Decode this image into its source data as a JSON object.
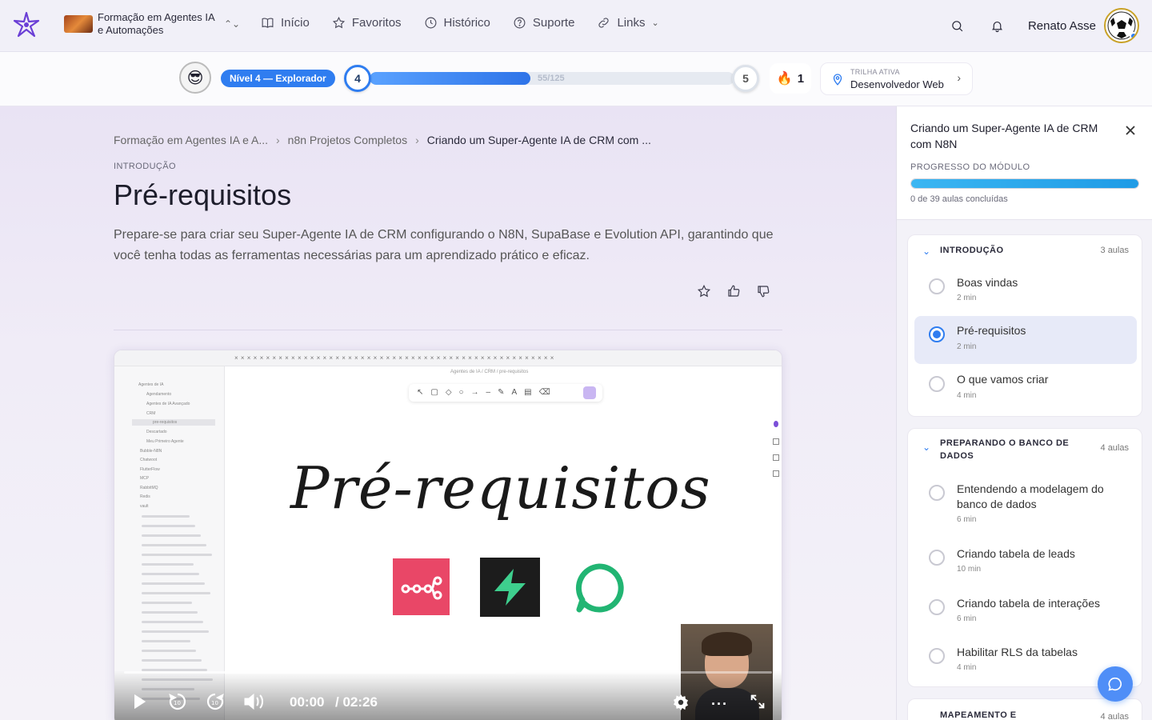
{
  "nav": {
    "course_name": "Formação em Agentes IA e Automações",
    "links": [
      {
        "label": "Início",
        "icon": "book-icon"
      },
      {
        "label": "Favoritos",
        "icon": "star-icon"
      },
      {
        "label": "Histórico",
        "icon": "clock-icon"
      },
      {
        "label": "Suporte",
        "icon": "help-icon"
      },
      {
        "label": "Links",
        "icon": "link-icon"
      }
    ],
    "user_name": "Renato Asse"
  },
  "level": {
    "badge": "Nível 4 — Explorador",
    "current_level": "4",
    "next_level": "5",
    "xp_text": "55/125",
    "xp_fraction": 0.44,
    "streak": "1",
    "trail_label": "TRILHA ATIVA",
    "trail_name": "Desenvolvedor Web"
  },
  "breadcrumb": {
    "items": [
      "Formação em Agentes IA e A...",
      "n8n Projetos Completos",
      "Criando um Super-Agente IA de CRM com ..."
    ]
  },
  "lesson": {
    "section": "INTRODUÇÃO",
    "title": "Pré-requisitos",
    "description": "Prepare-se para criar seu Super-Agente IA de CRM configurando o N8N, SupaBase e Evolution API, garantindo que você tenha todas as ferramentas necessárias para um aprendizado prático e eficaz."
  },
  "video": {
    "path_label": "Agentes de IA / CRM / pre-requisitos",
    "slide_title": "Pré-requisitos",
    "current_time": "00:00",
    "duration": "/ 02:26",
    "sidebar_items": [
      "Agentes de IA",
      "Agendamento",
      "Agentes de IA Avançado",
      "CRM",
      "pre-requisitos",
      "Descartado",
      "Meu Primeiro Agente",
      "Bubble-N8N",
      "Chatwoot",
      "FlutterFlow",
      "MCP",
      "RabbitMQ",
      "Redis",
      "vault"
    ]
  },
  "sidebar": {
    "title": "Criando um Super-Agente IA de CRM com N8N",
    "progress_label": "PROGRESSO DO MÓDULO",
    "progress_text": "0 de 39 aulas concluídas",
    "modules": [
      {
        "name": "INTRODUÇÃO",
        "count": "3 aulas",
        "lessons": [
          {
            "title": "Boas vindas",
            "duration": "2 min",
            "active": false
          },
          {
            "title": "Pré-requisitos",
            "duration": "2 min",
            "active": true
          },
          {
            "title": "O que vamos criar",
            "duration": "4 min",
            "active": false
          }
        ]
      },
      {
        "name": "PREPARANDO O BANCO DE DADOS",
        "count": "4 aulas",
        "lessons": [
          {
            "title": "Entendendo a modelagem do banco de dados",
            "duration": "6 min",
            "active": false
          },
          {
            "title": "Criando tabela de leads",
            "duration": "10 min",
            "active": false
          },
          {
            "title": "Criando tabela de interações",
            "duration": "6 min",
            "active": false
          },
          {
            "title": "Habilitar RLS da tabelas",
            "duration": "4 min",
            "active": false
          }
        ]
      },
      {
        "name": "MAPEAMENTO E",
        "count": "4 aulas",
        "lessons": []
      }
    ]
  },
  "colors": {
    "accent": "#2f7df0",
    "progress_fill": "#1f9be6",
    "n8n": "#e94767",
    "supabase": "#3ecf8e",
    "evolution": "#22b573"
  }
}
